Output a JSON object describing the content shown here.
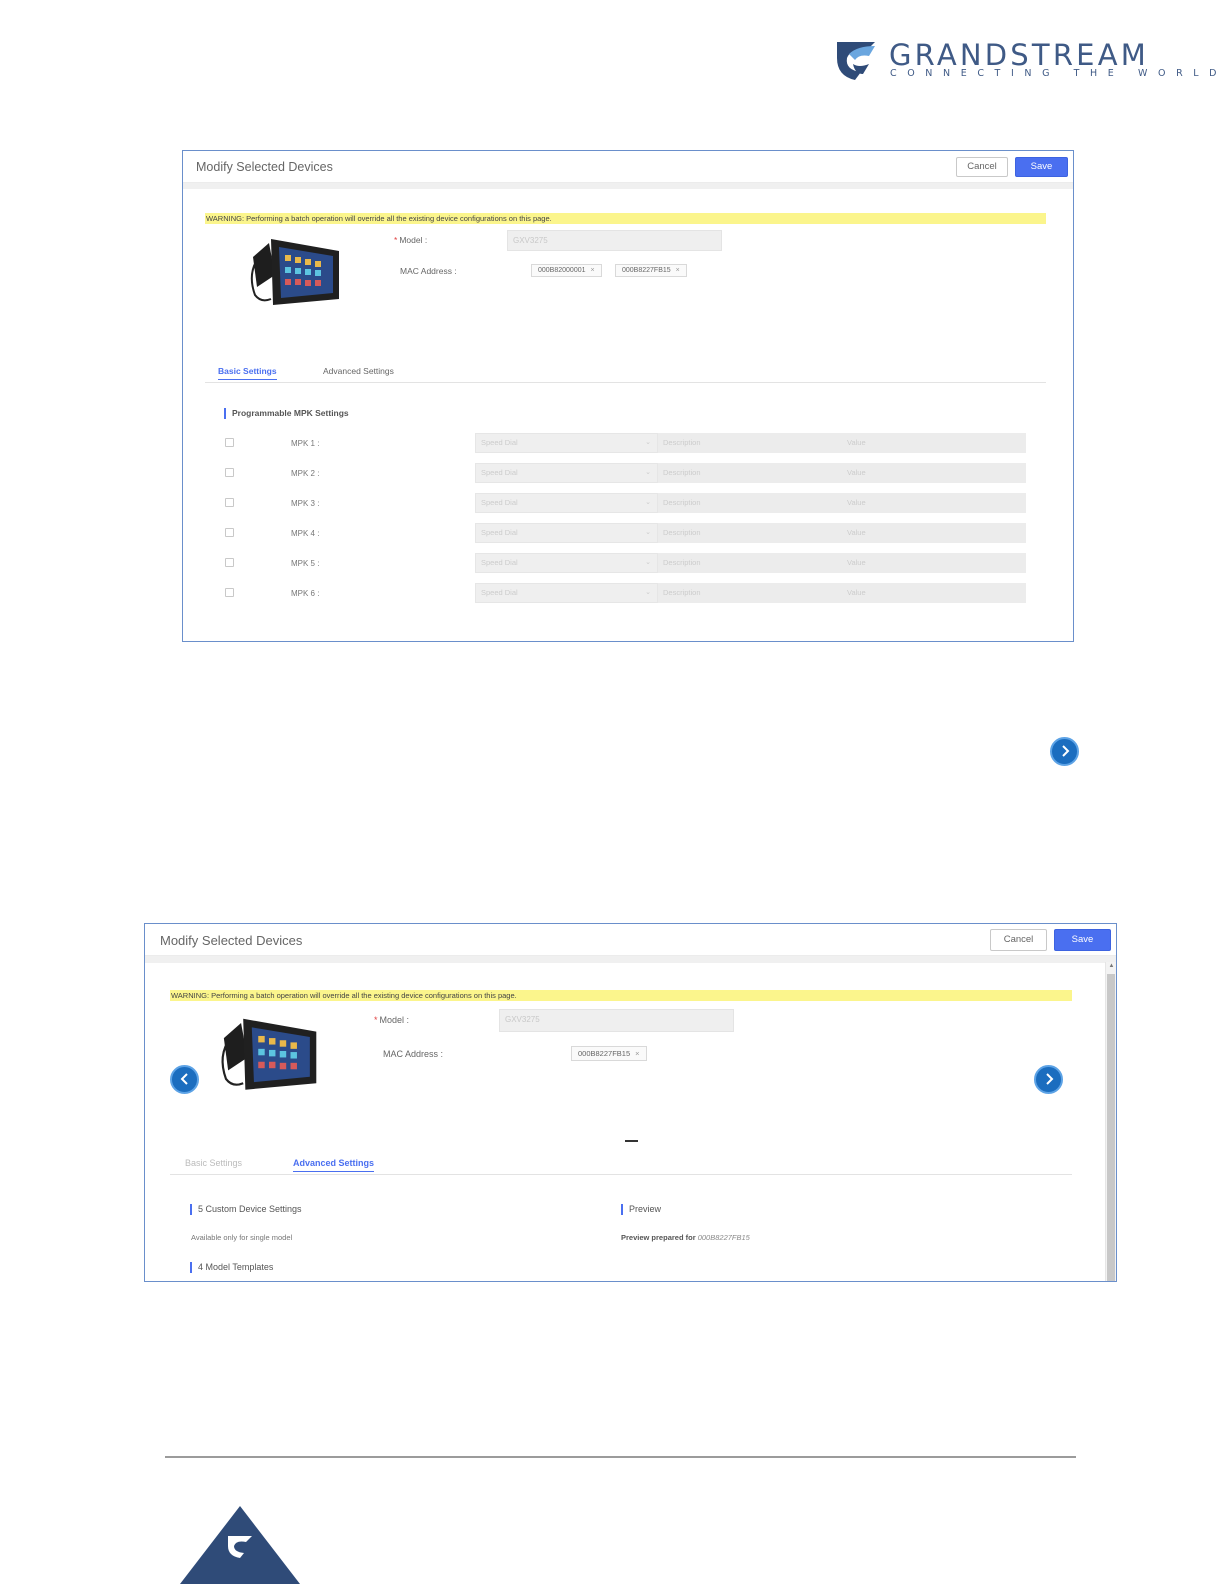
{
  "brand": {
    "name": "GRANDSTREAM",
    "tagline": "CONNECTING THE WORLD",
    "logo_icon": "grandstream-logo-icon",
    "color": "#3f5a86"
  },
  "dialog1": {
    "title": "Modify Selected Devices",
    "cancel_label": "Cancel",
    "save_label": "Save",
    "warning": "WARNING: Performing a batch operation will override all the existing device configurations on this page.",
    "model_label": "Model :",
    "model_value": "GXV3275",
    "mac_label": "MAC Address :",
    "mac_tags": [
      "000B82000001",
      "000B8227FB15"
    ],
    "tabs": [
      "Basic Settings",
      "Advanced Settings"
    ],
    "active_tab": "Basic Settings",
    "section_title": "Programmable MPK Settings",
    "mpk_rows": [
      {
        "label": "MPK 1 :",
        "type": "Speed Dial",
        "description": "Description",
        "value": "Value"
      },
      {
        "label": "MPK 2 :",
        "type": "Speed Dial",
        "description": "Description",
        "value": "Value"
      },
      {
        "label": "MPK 3 :",
        "type": "Speed Dial",
        "description": "Description",
        "value": "Value"
      },
      {
        "label": "MPK 4 :",
        "type": "Speed Dial",
        "description": "Description",
        "value": "Value"
      },
      {
        "label": "MPK 5 :",
        "type": "Speed Dial",
        "description": "Description",
        "value": "Value"
      },
      {
        "label": "MPK 6 :",
        "type": "Speed Dial",
        "description": "Description",
        "value": "Value"
      }
    ]
  },
  "dialog2": {
    "title": "Modify Selected Devices",
    "cancel_label": "Cancel",
    "save_label": "Save",
    "warning": "WARNING: Performing a batch operation will override all the existing device configurations on this page.",
    "model_label": "Model :",
    "model_value": "GXV3275",
    "mac_label": "MAC Address :",
    "mac_tags": [
      "000B8227FB15"
    ],
    "tabs": [
      "Basic Settings",
      "Advanced Settings"
    ],
    "active_tab": "Advanced Settings",
    "custom_settings_title": "5 Custom Device Settings",
    "custom_settings_note": "Available only for single model",
    "preview_title": "Preview",
    "preview_prefix": "Preview prepared for",
    "preview_mac": "000B8227FB15",
    "model_templates_title": "4 Model Templates"
  },
  "colors": {
    "accent": "#4a6ff0",
    "warning_bg": "#fbf58c",
    "nav_button": "#1b6dbf",
    "dialog_border": "#6a8fcb"
  }
}
